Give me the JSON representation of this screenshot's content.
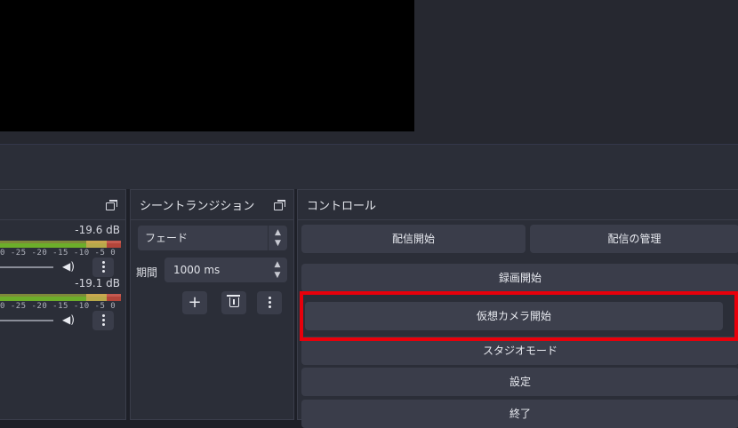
{
  "audio_mixer": {
    "tracks": [
      {
        "db": "-19.6 dB",
        "ticks": "0 -25 -20 -15 -10 -5 0"
      },
      {
        "db": "-19.1 dB",
        "ticks": "0 -25 -20 -15 -10 -5 0"
      }
    ],
    "speaker_glyph": "◀)"
  },
  "transitions": {
    "title": "シーントランジション",
    "selected": "フェード",
    "duration_label": "期間",
    "duration_value": "1000 ms",
    "add_glyph": "+"
  },
  "controls": {
    "title": "コントロール",
    "start_streaming": "配信開始",
    "manage_broadcast": "配信の管理",
    "start_recording": "録画開始",
    "start_virtual_camera": "仮想カメラ開始",
    "studio_mode": "スタジオモード",
    "settings": "設定",
    "exit": "終了"
  },
  "colors": {
    "highlight": "#e8000b",
    "background": "#1e2028",
    "panel": "#2b2e38",
    "button": "#3a3d4a"
  }
}
